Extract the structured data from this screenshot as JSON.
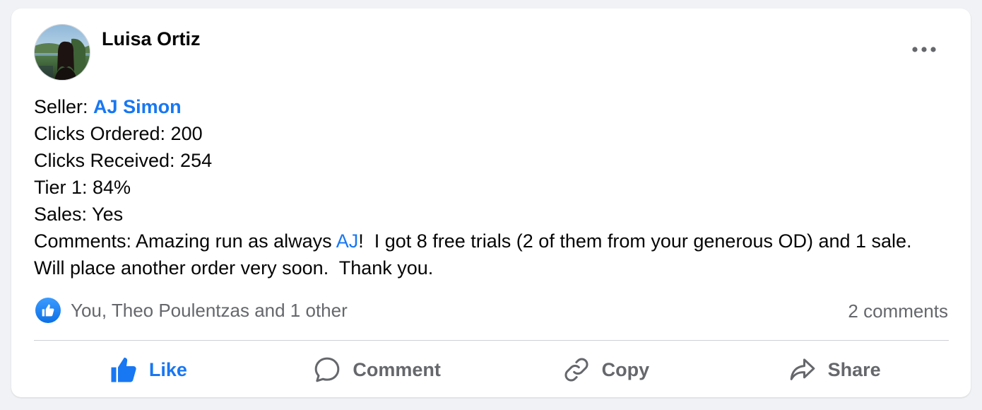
{
  "post": {
    "author": "Luisa Ortiz",
    "more_icon": "more-horizontal-icon",
    "body": {
      "seller_label": "Seller: ",
      "seller_name": "AJ Simon",
      "clicks_ordered": "Clicks Ordered: 200",
      "clicks_received": "Clicks Received: 254",
      "tier1": "Tier 1: 84%",
      "sales": "Sales: Yes",
      "comments_prefix": "Comments: Amazing run as always ",
      "comments_mention": "AJ",
      "comments_suffix": "!  I got 8 free trials (2 of them from your generous OD) and 1 sale.  Will place another order very soon.  Thank you."
    }
  },
  "reactions": {
    "icon": "like-reaction-icon",
    "summary": "You, Theo Poulentzas and 1 other",
    "comments_count": "2 comments"
  },
  "actions": {
    "like": "Like",
    "comment": "Comment",
    "copy": "Copy",
    "share": "Share"
  },
  "colors": {
    "accent": "#1877f2",
    "secondary_text": "#65676b",
    "background": "#f0f2f5"
  }
}
